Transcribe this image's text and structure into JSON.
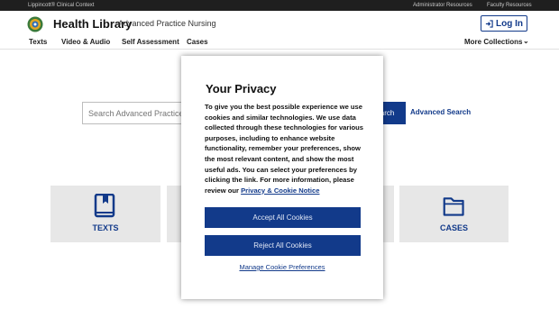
{
  "topbar": {
    "brand": "Lippincott® Clinical Context",
    "admin": "Administrator Resources",
    "faculty": "Faculty Resources"
  },
  "header": {
    "title": "Health Library",
    "subtitle": "Advanced Practice Nursing",
    "login_label": "Log In"
  },
  "nav": {
    "items": [
      "Texts",
      "Video & Audio",
      "Self Assessment",
      "Cases"
    ],
    "more_label": "More Collections"
  },
  "search": {
    "placeholder": "Search Advanced Practice",
    "button_label": "Search",
    "advanced_link": "Advanced Search"
  },
  "tiles": {
    "texts_label": "TEXTS",
    "cases_label": "CASES"
  },
  "modal": {
    "title": "Your Privacy",
    "body": "To give you the best possible experience we use cookies and similar technologies. We use data collected through these technologies for various purposes, including to enhance website functionality, remember your preferences, show the most relevant content, and show the most useful ads. You can select your preferences by clicking the link. For more information, please review our ",
    "link_text": "Privacy & Cookie Notice",
    "accept_label": "Accept All Cookies",
    "reject_label": "Reject All Cookies",
    "manage_label": "Manage Cookie Preferences"
  },
  "colors": {
    "accent": "#123a8a",
    "topbar_bg": "#1f1f1f",
    "tile_bg": "#e7e7e7"
  }
}
